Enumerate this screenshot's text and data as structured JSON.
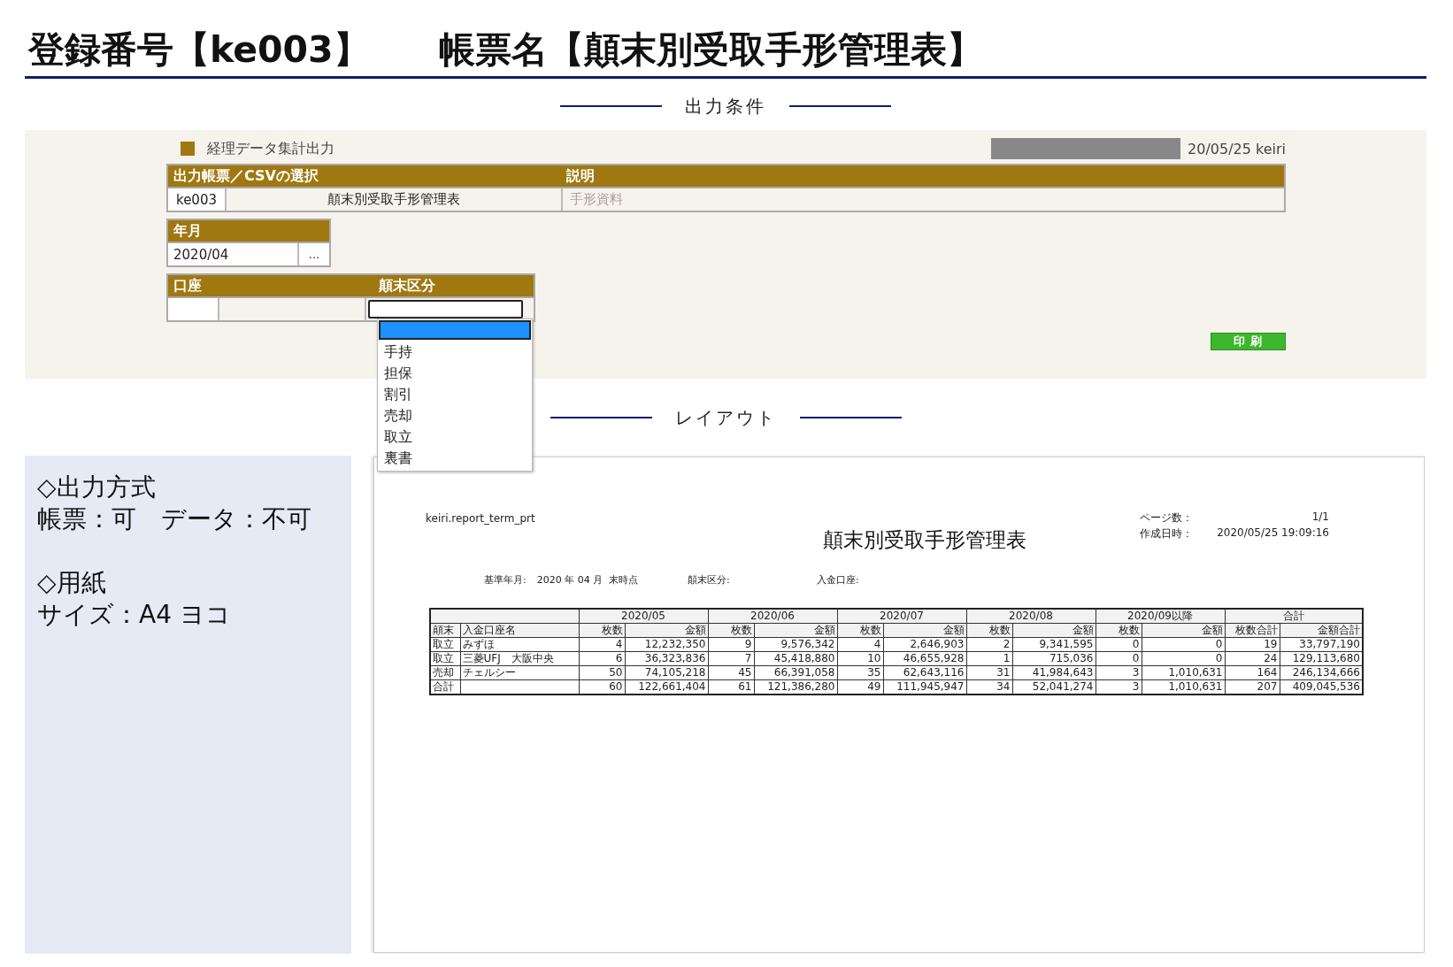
{
  "title": {
    "registration": "登録番号【ke003】",
    "report_name": "帳票名【顛末別受取手形管理表】"
  },
  "output_conditions": {
    "heading": "出力条件",
    "app_label": "経理データ集計出力",
    "login_info": "20/05/25 keiri",
    "report_select": {
      "header": "出力帳票／CSVの選択",
      "description_header": "説明",
      "code": "ke003",
      "name": "顛末別受取手形管理表",
      "description": "手形資料"
    },
    "year_month": {
      "header": "年月",
      "value": "2020/04",
      "button": "..."
    },
    "account": {
      "header": "口座"
    },
    "disposition": {
      "header": "顛末区分",
      "expanded": true,
      "options": [
        {
          "selected": true
        },
        {
          "label": "手持",
          "selected": false
        },
        {
          "label": "担保",
          "selected": false
        },
        {
          "label": "割引",
          "selected": false
        },
        {
          "label": "売却",
          "selected": false
        },
        {
          "label": "取立",
          "selected": false
        },
        {
          "label": "裏書",
          "selected": false
        }
      ]
    },
    "print_button": "印 刷"
  },
  "layout_heading": "レイアウト",
  "notes": [
    {
      "heading": "◇出力方式",
      "text": "帳票：可　データ：不可"
    },
    {
      "heading": "◇用紙",
      "text": "サイズ：A4 ヨコ"
    }
  ],
  "report": {
    "program_id": "keiri.report_term_prt",
    "title": "顛末別受取手形管理表",
    "meta": [
      {
        "label": "ページ数：",
        "value": "1/1"
      },
      {
        "label": "作成日時：",
        "value": "2020/05/25 19:09:16"
      }
    ],
    "conditions": [
      {
        "label": "基準年月:",
        "value": "2020 年 04 月  末時点"
      },
      {
        "label": "顛末区分:"
      },
      {
        "label": "入金口座:"
      }
    ],
    "table": {
      "groups": [
        "2020/05",
        "2020/06",
        "2020/07",
        "2020/08",
        "2020/09以降",
        "合計"
      ],
      "subheaders": [
        "顛末",
        "入金口座名",
        "枚数",
        "金額",
        "枚数",
        "金額",
        "枚数",
        "金額",
        "枚数",
        "金額",
        "枚数",
        "金額",
        "枚数合計",
        "金額合計"
      ],
      "rows": [
        [
          "取立",
          "みずほ",
          "4",
          "12,232,350",
          "9",
          "9,576,342",
          "4",
          "2,646,903",
          "2",
          "9,341,595",
          "0",
          "0",
          "19",
          "33,797,190"
        ],
        [
          "取立",
          "三菱UFJ　大阪中央",
          "6",
          "36,323,836",
          "7",
          "45,418,880",
          "10",
          "46,655,928",
          "1",
          "715,036",
          "0",
          "0",
          "24",
          "129,113,680"
        ],
        [
          "売却",
          "チェルシー",
          "50",
          "74,105,218",
          "45",
          "66,391,058",
          "35",
          "62,643,116",
          "31",
          "41,984,643",
          "3",
          "1,010,631",
          "164",
          "246,134,666"
        ],
        [
          "合計",
          "",
          "60",
          "122,661,404",
          "61",
          "121,386,280",
          "49",
          "111,945,947",
          "34",
          "52,041,274",
          "3",
          "1,010,631",
          "207",
          "409,045,536"
        ]
      ]
    }
  }
}
